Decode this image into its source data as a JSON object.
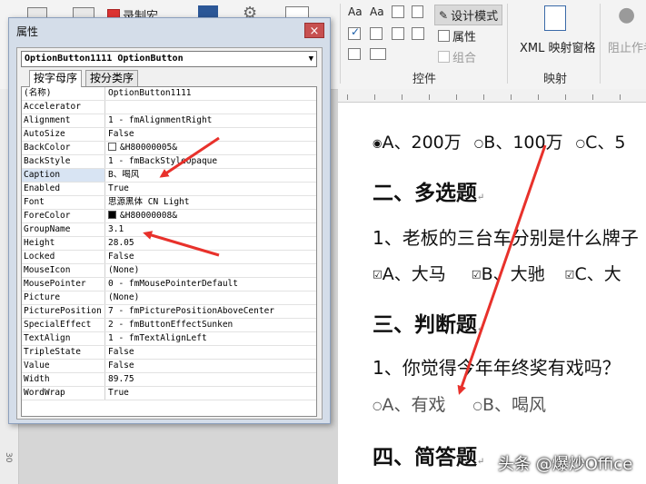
{
  "ribbon": {
    "macro_label": "录制宏",
    "design_mode_label": "设计模式",
    "properties_label": "属性",
    "group_label": "组合",
    "xml_pane_label": "XML 映射窗格",
    "block_author_label": "阻止作者",
    "controls_group": "控件",
    "mapping_group": "映射"
  },
  "props": {
    "title": "属性",
    "close_glyph": "×",
    "object": "OptionButton1111 OptionButton",
    "tab_alpha": "按字母序",
    "tab_category": "按分类序",
    "rows": [
      {
        "k": "(名称)",
        "v": "OptionButton1111"
      },
      {
        "k": "Accelerator",
        "v": ""
      },
      {
        "k": "Alignment",
        "v": "1 - fmAlignmentRight"
      },
      {
        "k": "AutoSize",
        "v": "False"
      },
      {
        "k": "BackColor",
        "v": "&H80000005&",
        "swatch": "#ffffff"
      },
      {
        "k": "BackStyle",
        "v": "1 - fmBackStyleOpaque"
      },
      {
        "k": "Caption",
        "v": "B、喝风"
      },
      {
        "k": "Enabled",
        "v": "True"
      },
      {
        "k": "Font",
        "v": "思源黑体 CN Light"
      },
      {
        "k": "ForeColor",
        "v": "&H80000008&",
        "swatch": "#000000"
      },
      {
        "k": "GroupName",
        "v": "3.1"
      },
      {
        "k": "Height",
        "v": "28.05"
      },
      {
        "k": "Locked",
        "v": "False"
      },
      {
        "k": "MouseIcon",
        "v": "(None)"
      },
      {
        "k": "MousePointer",
        "v": "0 - fmMousePointerDefault"
      },
      {
        "k": "Picture",
        "v": "(None)"
      },
      {
        "k": "PicturePosition",
        "v": "7 - fmPicturePositionAboveCenter"
      },
      {
        "k": "SpecialEffect",
        "v": "2 - fmButtonEffectSunken"
      },
      {
        "k": "TextAlign",
        "v": "1 - fmTextAlignLeft"
      },
      {
        "k": "TripleState",
        "v": "False"
      },
      {
        "k": "Value",
        "v": "False"
      },
      {
        "k": "Width",
        "v": "89.75"
      },
      {
        "k": "WordWrap",
        "v": "True"
      }
    ]
  },
  "doc": {
    "q1_options": {
      "a": "A、200万",
      "b": "B、100万",
      "c": "C、5"
    },
    "section2": "二、多选题",
    "q2": "1、老板的三台车分别是什么牌子",
    "q2_options": {
      "a": "A、大马",
      "b": "B、大驰",
      "c": "C、大"
    },
    "section3": "三、判断题",
    "q3": "1、你觉得今年年终奖有戏吗？",
    "q3_options": {
      "a": "A、有戏",
      "b": "B、喝风"
    },
    "section4": "四、简答题",
    "ruler_num": "30"
  },
  "watermark": "头条 @爆炒Office",
  "colors": {
    "arrow": "#e8312b",
    "close": "#c75050"
  }
}
